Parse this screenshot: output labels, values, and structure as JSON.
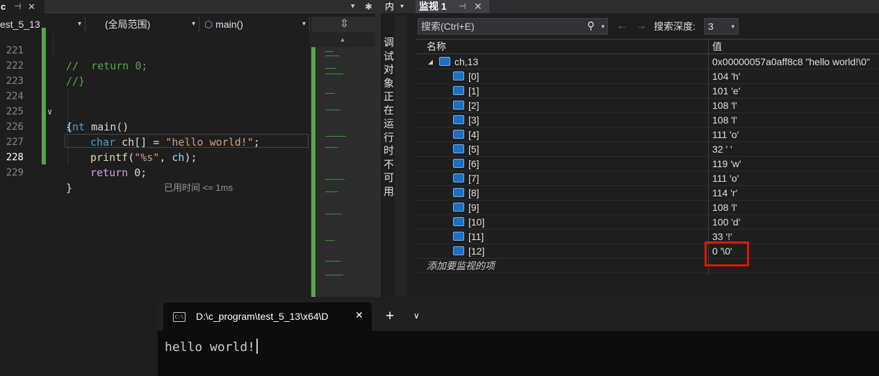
{
  "editor": {
    "tab": {
      "label": "c",
      "pin": "⊣",
      "close": "✕"
    },
    "tab_dropdown": "▾",
    "tab_settings": "✱",
    "nav": {
      "project": "est_5_13",
      "scope": "(全局范围)",
      "member": "main()",
      "split": "⇳"
    },
    "lines": [
      {
        "num": "221",
        "code": "//  return 0;"
      },
      {
        "num": "222",
        "code": "//}"
      },
      {
        "num": "223",
        "code": ""
      },
      {
        "num": "224",
        "kw": "int",
        "fn": " main",
        "rest": "()"
      },
      {
        "num": "225",
        "code": "{"
      },
      {
        "num": "226",
        "kw": "char",
        "var": " ch",
        "rest1": "[] = ",
        "str": "\"hello world!\"",
        "rest2": ";"
      },
      {
        "num": "227",
        "fn": "printf",
        "rest1": "(",
        "str": "\"%s\"",
        "rest2": ", ",
        "var": "ch",
        "rest3": ");"
      },
      {
        "num": "228",
        "kw": "return",
        "rest": " 0;"
      },
      {
        "num": "229",
        "code": "}"
      }
    ],
    "elapsed": "已用时间 <= 1ms"
  },
  "inner_panel": {
    "title": "内",
    "dropdown": "▾",
    "message": "调试对象正在运行时不可用。"
  },
  "watch": {
    "title": "监视 1",
    "pin": "⊣",
    "close": "✕",
    "search_placeholder": "搜索(Ctrl+E)",
    "search_icon": "search-icon",
    "depth_label": "搜索深度:",
    "depth_value": "3",
    "columns": {
      "name": "名称",
      "value": "值"
    },
    "root": {
      "name": "ch,13",
      "value": "0x00000057a0aff8c8 \"hello world!\\0\""
    },
    "items": [
      {
        "name": "[0]",
        "value": "104 'h'"
      },
      {
        "name": "[1]",
        "value": "101 'e'"
      },
      {
        "name": "[2]",
        "value": "108 'l'"
      },
      {
        "name": "[3]",
        "value": "108 'l'"
      },
      {
        "name": "[4]",
        "value": "111 'o'"
      },
      {
        "name": "[5]",
        "value": "32 ' '"
      },
      {
        "name": "[6]",
        "value": "119 'w'"
      },
      {
        "name": "[7]",
        "value": "111 'o'"
      },
      {
        "name": "[8]",
        "value": "114 'r'"
      },
      {
        "name": "[9]",
        "value": "108 'l'"
      },
      {
        "name": "[10]",
        "value": "100 'd'"
      },
      {
        "name": "[11]",
        "value": "33 '!'"
      },
      {
        "name": "[12]",
        "value": "0 '\\0'"
      }
    ],
    "add_item": "添加要监视的项",
    "highlight_color": "#e51400"
  },
  "terminal": {
    "tab_title": "D:\\c_program\\test_5_13\\x64\\D",
    "icon": "C:\\",
    "close": "✕",
    "new_tab": "+",
    "dropdown": "⌄",
    "output": "hello world!"
  },
  "colors": {
    "keyword": "#569cd6",
    "control_keyword": "#d8a0df",
    "string": "#d69d85",
    "comment": "#57a64a",
    "function": "#dcdcaa",
    "variable": "#9cdcfe"
  }
}
